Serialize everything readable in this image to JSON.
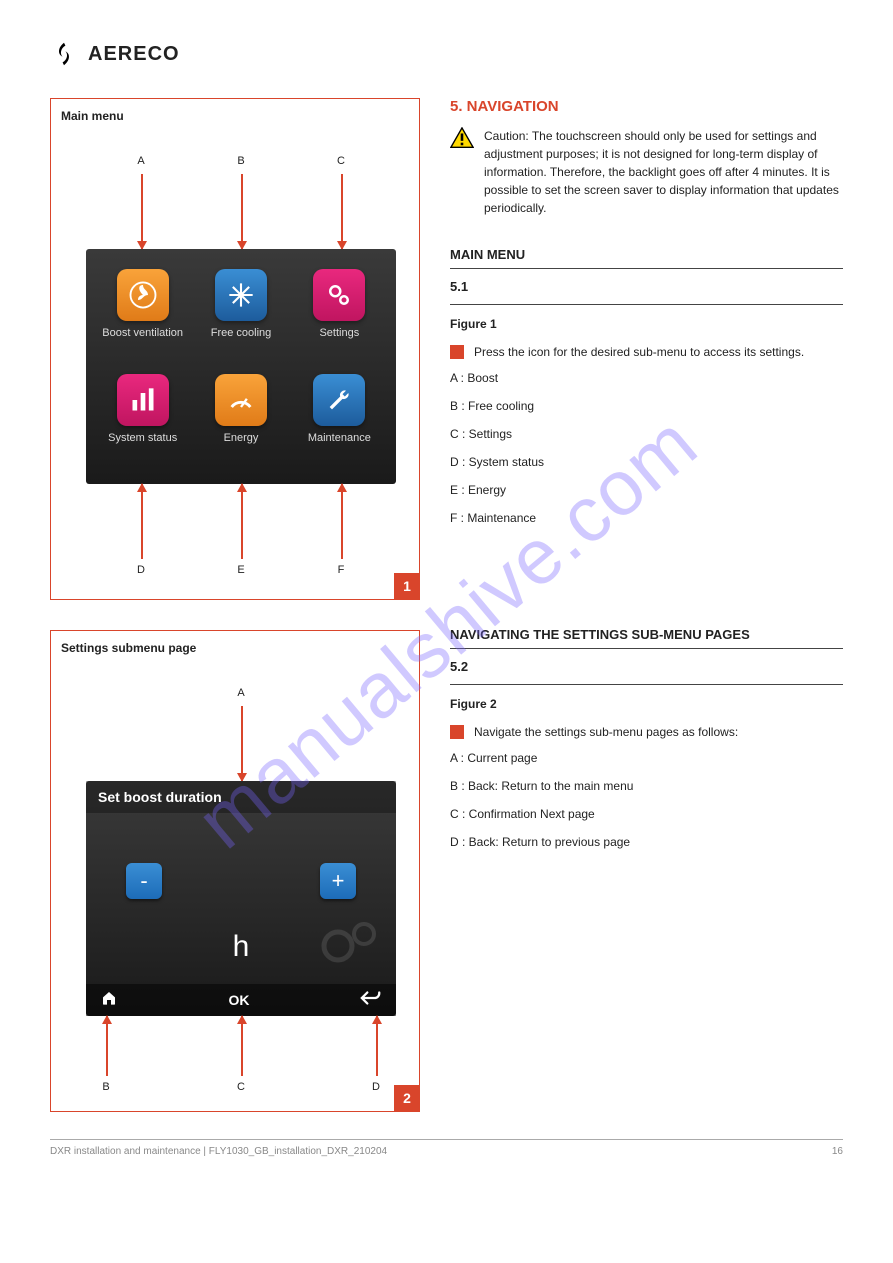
{
  "header": {
    "brand": "AERECO"
  },
  "watermark": "manualshive.com",
  "figure1": {
    "title": "Main menu",
    "labels": {
      "a": "A",
      "b": "B",
      "c": "C",
      "d": "D",
      "e": "E",
      "f": "F"
    },
    "tiles": {
      "boost": "Boost ventilation",
      "free": "Free cooling",
      "settings": "Settings",
      "status": "System status",
      "energy": "Energy",
      "maint": "Maintenance"
    },
    "number": "1"
  },
  "figure2": {
    "title": "Settings submenu page",
    "screenTitle": "Set boost duration",
    "minus": "-",
    "plus": "+",
    "unit": "h",
    "ok": "OK",
    "labels": {
      "a": "A",
      "b": "B",
      "c": "C",
      "d": "D"
    },
    "number": "2"
  },
  "section": {
    "heading": "5. NAVIGATION",
    "warnText": "Caution: The touchscreen should only be used for settings and adjustment purposes; it is not designed for long-term display of information. Therefore, the backlight goes off after 4 minutes. It is possible to set the screen saver to display information that updates periodically.",
    "mainMenu": {
      "head": "MAIN MENU",
      "num": "5.1",
      "fig": "Figure 1",
      "text": "Press the icon for the desired sub-menu to access its settings.",
      "items": {
        "a": "A : Boost",
        "b": "B : Free cooling",
        "c": "C : Settings",
        "d": "D : System status",
        "e": "E : Energy",
        "f": "F : Maintenance"
      }
    },
    "subMenu": {
      "head": "NAVIGATING THE SETTINGS SUB-MENU PAGES",
      "num": "5.2",
      "fig": "Figure 2",
      "text": "Navigate the settings sub-menu pages as follows:",
      "items": {
        "a": "A : Current page",
        "b": "B : Back: Return to the main menu",
        "c": "C : Confirmation Next page",
        "d": "D : Back: Return to previous page"
      }
    }
  },
  "footer": {
    "left": "DXR installation and maintenance | FLY1030_GB_installation_DXR_210204",
    "right": "16"
  }
}
